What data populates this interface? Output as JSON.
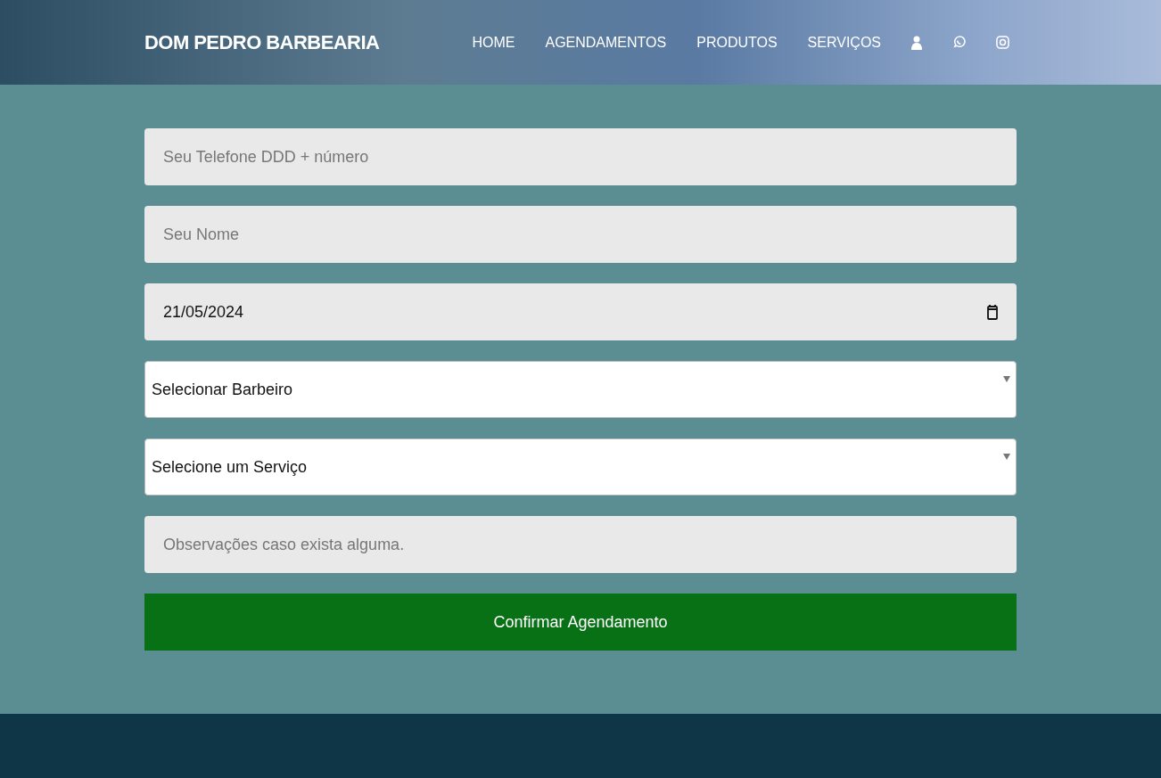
{
  "header": {
    "brand": "DOM PEDRO BARBEARIA",
    "nav": [
      {
        "label": "HOME"
      },
      {
        "label": "AGENDAMENTOS"
      },
      {
        "label": "PRODUTOS"
      },
      {
        "label": "SERVIÇOS"
      }
    ]
  },
  "form": {
    "fields": [
      {
        "kind": "text",
        "placeholder": "Seu Telefone DDD + número"
      },
      {
        "kind": "text",
        "placeholder": "Seu Nome"
      },
      {
        "kind": "date",
        "value": "21/05/2024"
      },
      {
        "kind": "select",
        "value": "Selecionar Barbeiro"
      },
      {
        "kind": "select",
        "value": "Selecione um Serviço"
      },
      {
        "kind": "text",
        "placeholder": "Observações caso exista alguma."
      }
    ],
    "submit": "Confirmar Agendamento"
  }
}
